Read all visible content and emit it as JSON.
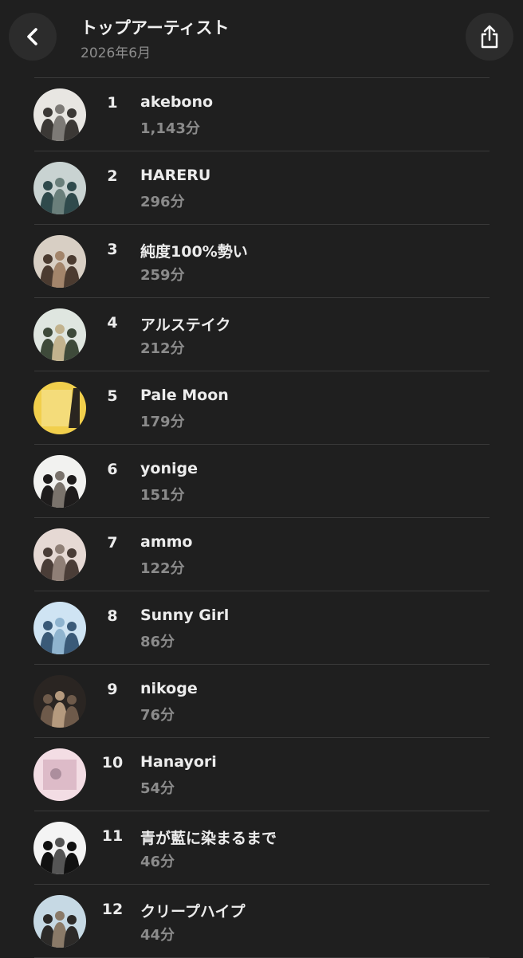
{
  "header": {
    "title": "トップアーティスト",
    "subtitle": "2026年6月",
    "back_icon": "chevron-left-icon",
    "share_icon": "share-icon"
  },
  "artists": [
    {
      "rank": "1",
      "name": "akebono",
      "minutes": "1,143分",
      "colors": [
        "#e8e6e2",
        "#3b3835",
        "#7d7a76"
      ]
    },
    {
      "rank": "2",
      "name": "HARERU",
      "minutes": "296分",
      "colors": [
        "#c9d3d2",
        "#2f4a4c",
        "#6a7f7b"
      ]
    },
    {
      "rank": "3",
      "name": "純度100%勢い",
      "minutes": "259分",
      "colors": [
        "#d8cfc4",
        "#4b3b30",
        "#a3856b"
      ]
    },
    {
      "rank": "4",
      "name": "アルステイク",
      "minutes": "212分",
      "colors": [
        "#dfe6e0",
        "#3e4a3a",
        "#c2b38e"
      ]
    },
    {
      "rank": "5",
      "name": "Pale Moon",
      "minutes": "179分",
      "colors": [
        "#f1cf4c",
        "#f6e7a0",
        "#2a2520"
      ]
    },
    {
      "rank": "6",
      "name": "yonige",
      "minutes": "151分",
      "colors": [
        "#f2f2f0",
        "#1e1c1c",
        "#7a736c"
      ]
    },
    {
      "rank": "7",
      "name": "ammo",
      "minutes": "122分",
      "colors": [
        "#e6d9d4",
        "#4a3d37",
        "#8f7f76"
      ]
    },
    {
      "rank": "8",
      "name": "Sunny Girl",
      "minutes": "86分",
      "colors": [
        "#cfe4f3",
        "#3a5a78",
        "#8fb4cf"
      ]
    },
    {
      "rank": "9",
      "name": "nikoge",
      "minutes": "76分",
      "colors": [
        "#2a2522",
        "#6e5a4a",
        "#b59a7e"
      ]
    },
    {
      "rank": "10",
      "name": "Hanayori",
      "minutes": "54分",
      "colors": [
        "#f3dde4",
        "#c89aab",
        "#8c6f80"
      ]
    },
    {
      "rank": "11",
      "name": "青が藍に染まるまで",
      "minutes": "46分",
      "colors": [
        "#f4f4f4",
        "#111111",
        "#555555"
      ]
    },
    {
      "rank": "12",
      "name": "クリープハイプ",
      "minutes": "44分",
      "colors": [
        "#c6d9e4",
        "#2c2a28",
        "#8a7a68"
      ]
    }
  ]
}
